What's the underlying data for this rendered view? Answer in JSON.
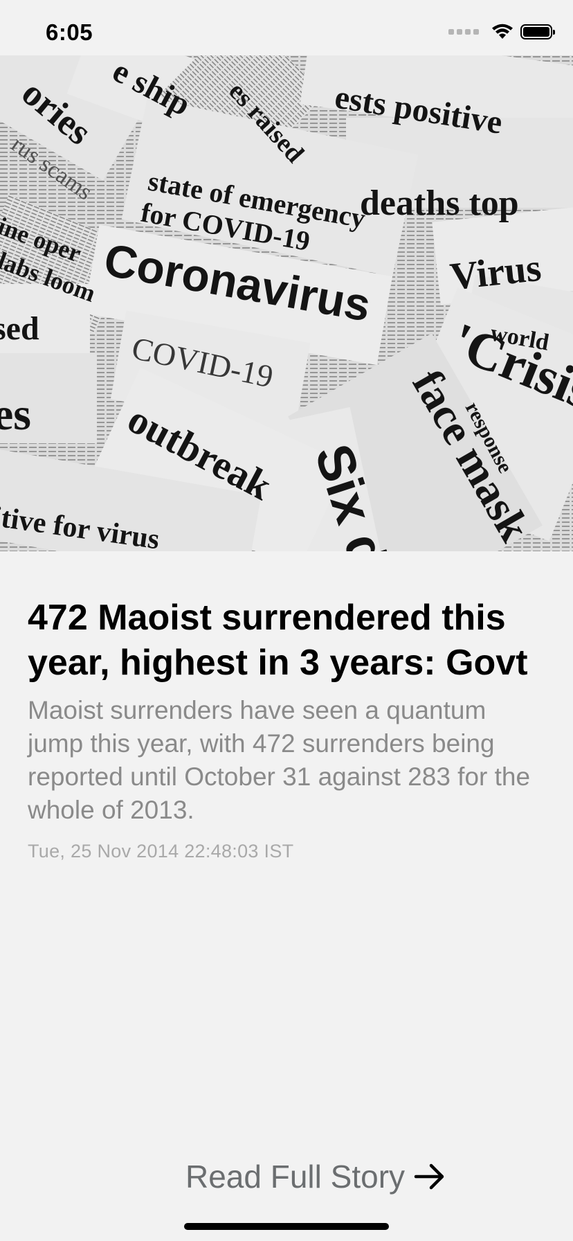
{
  "status_bar": {
    "time": "6:05"
  },
  "hero": {
    "headline_clips": [
      "Coronavirus",
      "COVID-19",
      "state of emergency",
      "for COVID-19",
      "deaths top",
      "Virus",
      "'Crisis",
      "face mask",
      "Six de",
      "outbreak",
      "itive for virus",
      "ests positive",
      "e ship",
      "es raised",
      "world",
      "response",
      "sed",
      "es",
      "ories",
      "ine oper",
      "labs loom",
      "rus scams"
    ]
  },
  "article": {
    "headline": "472 Maoist surrendered this year, highest in 3 years: Govt",
    "summary": "Maoist surrenders have seen a quantum jump this year, with 472 surrenders being reported until October 31 against 283 for the whole of 2013.",
    "timestamp": "Tue, 25 Nov 2014 22:48:03 IST"
  },
  "footer": {
    "read_full_label": "Read Full Story",
    "arrow_icon": "arrow-right-icon"
  }
}
